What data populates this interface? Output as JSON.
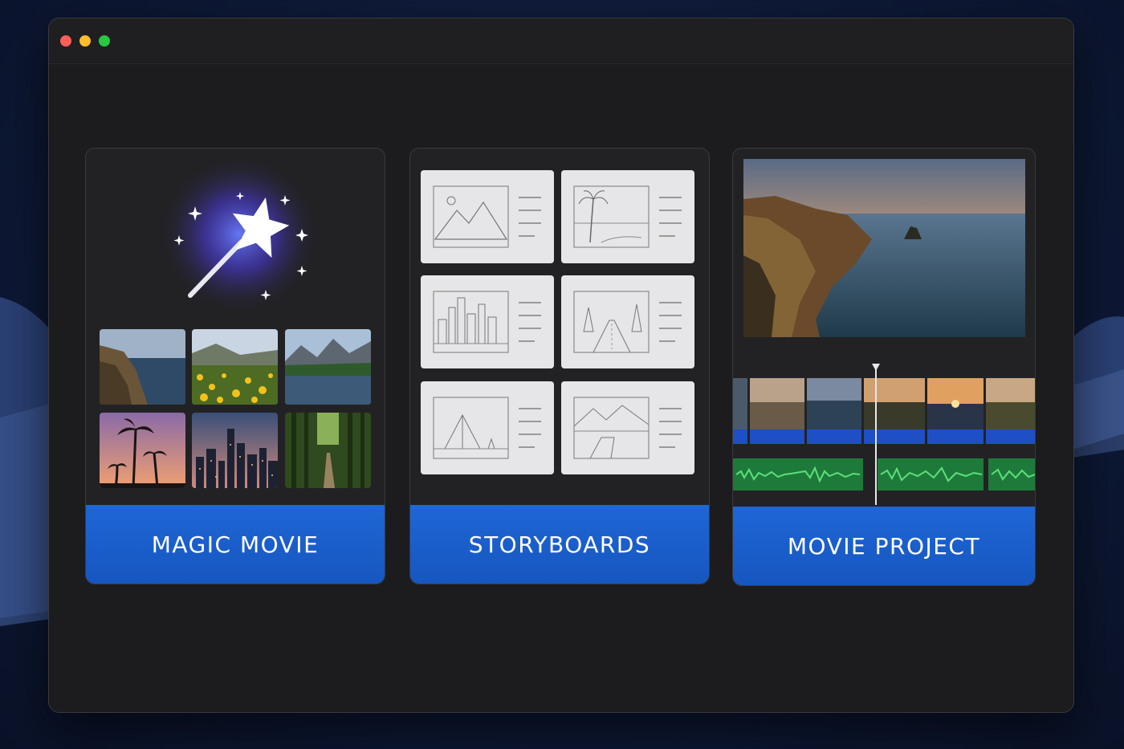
{
  "window": {
    "traffic_lights": [
      "#ff5f57",
      "#febc2e",
      "#28c840"
    ]
  },
  "cards": [
    {
      "label": "MAGIC MOVIE",
      "icon": "magic-wand-icon",
      "thumbnails": [
        "coastline-photo",
        "wildflower-meadow-photo",
        "mountain-lake-photo",
        "palm-sunset-photo",
        "city-skyline-photo",
        "forest-path-photo"
      ]
    },
    {
      "label": "STORYBOARDS",
      "templates": [
        "mountain-sketch",
        "beach-palm-sketch",
        "city-sketch",
        "road-trees-sketch",
        "camping-sketch",
        "lake-dock-sketch"
      ]
    },
    {
      "label": "MOVIE PROJECT",
      "preview": "coastal-cliffs-sunset-photo",
      "timeline": {
        "video_clips": 6,
        "audio_tracks": 3
      }
    }
  ],
  "colors": {
    "accent": "#1f66d6",
    "audio_track": "#1e7a3a",
    "video_track": "#1e4fc4"
  }
}
